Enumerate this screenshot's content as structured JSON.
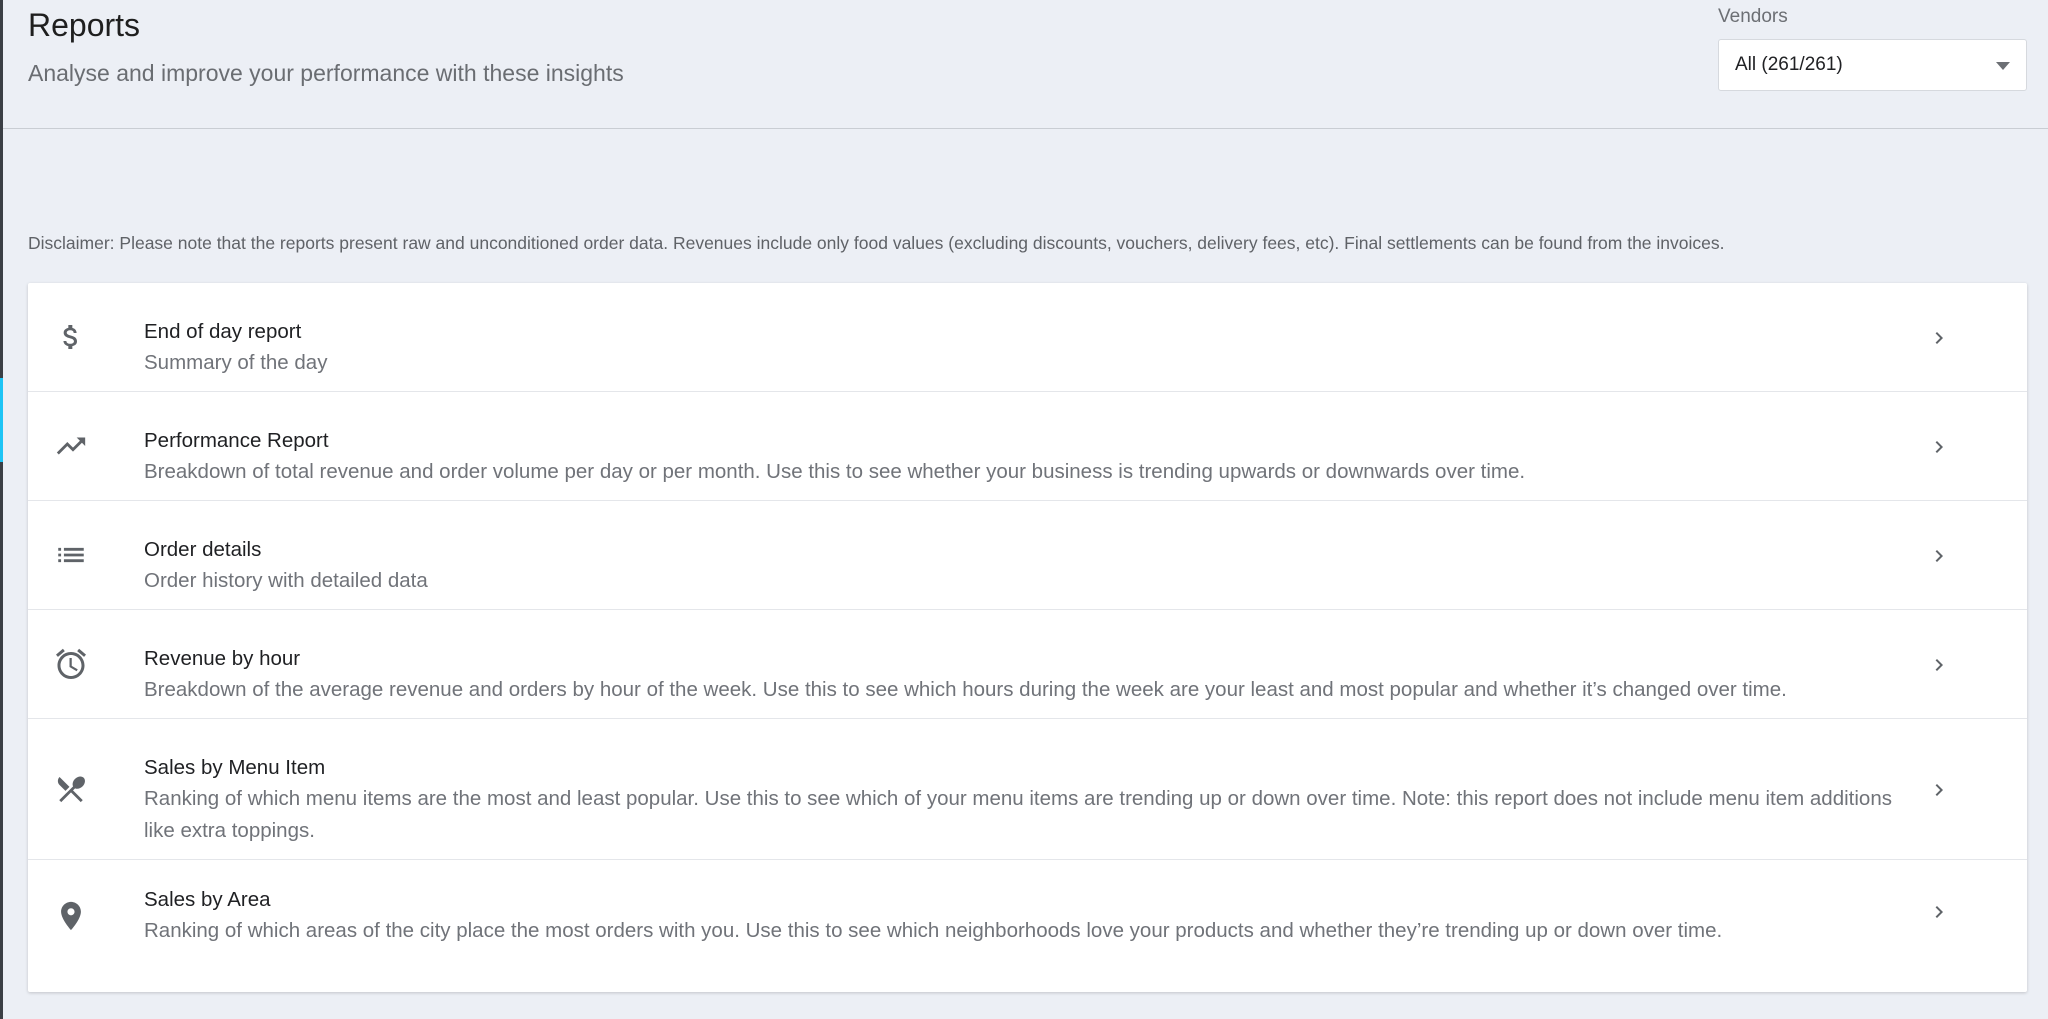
{
  "header": {
    "title": "Reports",
    "subtitle": "Analyse and improve your performance with these insights"
  },
  "vendors": {
    "label": "Vendors",
    "selected": "All (261/261)"
  },
  "disclaimer": "Disclaimer: Please note that the reports present raw and unconditioned order data. Revenues include only food values (excluding discounts, vouchers, delivery fees, etc). Final settlements can be found from the invoices.",
  "reports": [
    {
      "icon": "dollar-icon",
      "title": "End of day report",
      "description": "Summary of the day"
    },
    {
      "icon": "trending-up-icon",
      "title": "Performance Report",
      "description": "Breakdown of total revenue and order volume per day or per month. Use this to see whether your business is trending upwards or downwards over time."
    },
    {
      "icon": "list-icon",
      "title": "Order details",
      "description": "Order history with detailed data"
    },
    {
      "icon": "alarm-clock-icon",
      "title": "Revenue by hour",
      "description": "Breakdown of the average revenue and orders by hour of the week. Use this to see which hours during the week are your least and most popular and whether it’s changed over time."
    },
    {
      "icon": "fork-spoon-icon",
      "title": "Sales by Menu Item",
      "description": "Ranking of which menu items are the most and least popular. Use this to see which of your menu items are trending up or down over time. Note: this report does not include menu item additions like extra toppings."
    },
    {
      "icon": "location-pin-icon",
      "title": "Sales by Area",
      "description": "Ranking of which areas of the city place the most orders with you. Use this to see which neighborhoods love your products and whether they’re trending up or down over time."
    }
  ]
}
